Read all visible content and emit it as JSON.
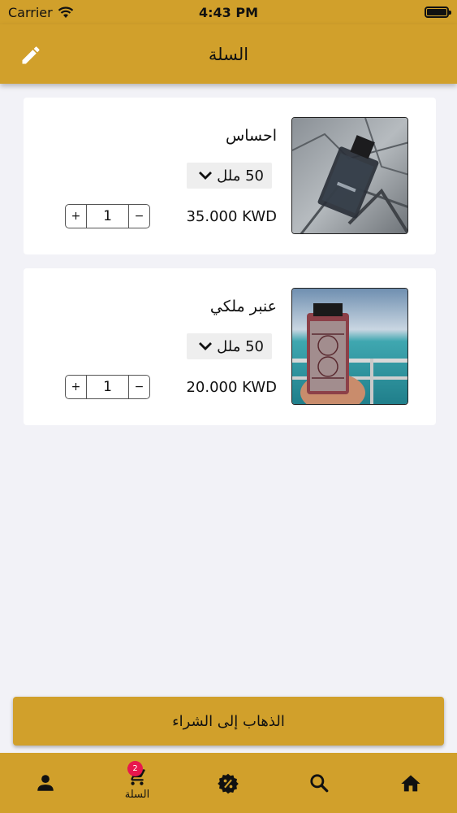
{
  "status_bar": {
    "carrier": "Carrier",
    "time": "4:43 PM"
  },
  "header": {
    "title": "السلة",
    "edit_icon": "pencil-icon"
  },
  "cart": {
    "items": [
      {
        "name": "احساس",
        "size": "50 ملل",
        "price": "35.000 KWD",
        "quantity": "1",
        "plus": "+",
        "minus": "−"
      },
      {
        "name": "عنبر ملكي",
        "size": "50 ملل",
        "price": "20.000 KWD",
        "quantity": "1",
        "plus": "+",
        "minus": "−"
      }
    ]
  },
  "checkout": {
    "label": "الذهاب إلى الشراء"
  },
  "bottom_nav": {
    "items": [
      {
        "icon": "person-icon",
        "label": ""
      },
      {
        "icon": "cart-icon",
        "label": "السلة",
        "badge": "2"
      },
      {
        "icon": "discount-badge-icon",
        "label": ""
      },
      {
        "icon": "search-icon",
        "label": ""
      },
      {
        "icon": "home-icon",
        "label": ""
      }
    ]
  },
  "colors": {
    "brand": "#d1a02b",
    "badge": "#e8174d",
    "background": "#f2f2f7"
  }
}
